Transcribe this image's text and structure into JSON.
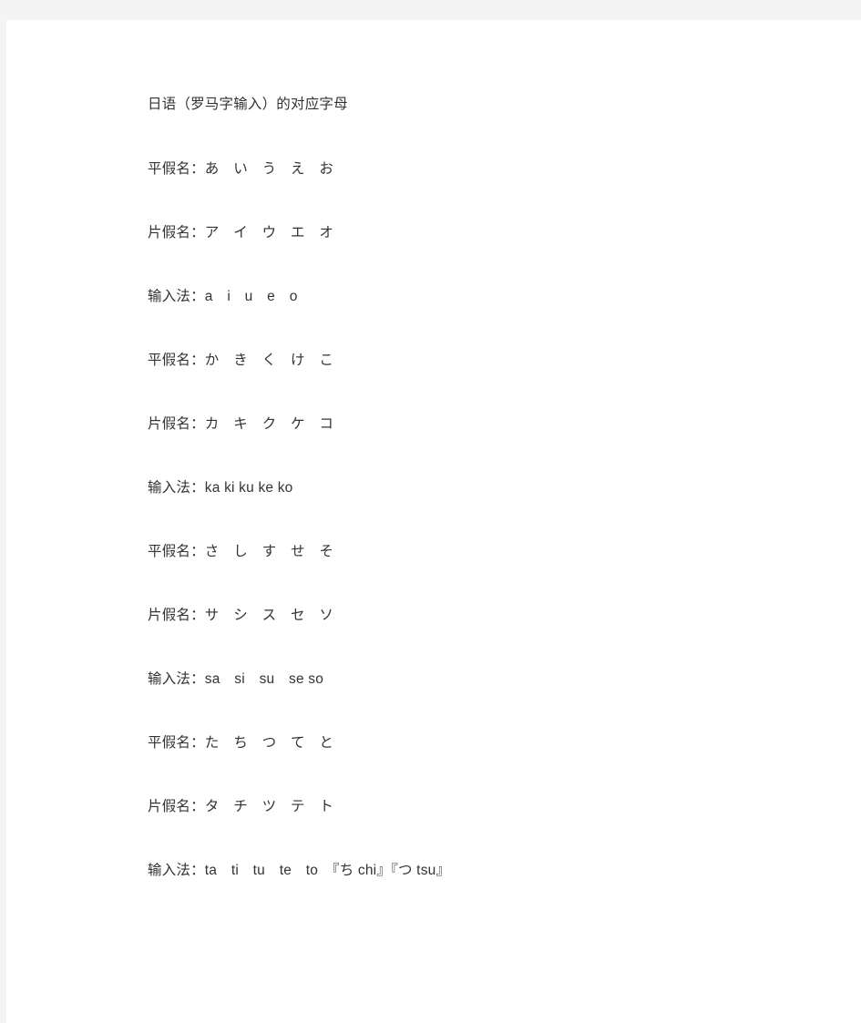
{
  "page": {
    "background_color": "#ffffff",
    "gutter_color": "#f4f4f4",
    "text_color": "#333333"
  },
  "document": {
    "title": "日语（罗马字输入）的对应字母",
    "labels": {
      "hiragana": "平假名",
      "katakana": "片假名",
      "input_method": "输入法"
    },
    "lines": [
      {
        "name": "title",
        "text": "日语（罗马字输入）的对应字母"
      },
      {
        "name": "hiragana-a-row",
        "text": "平假名：あ　い　う　え　お"
      },
      {
        "name": "katakana-a-row",
        "text": "片假名：ア　イ　ウ　エ　オ"
      },
      {
        "name": "romaji-a-row",
        "text": "输入法：a　i　u　e　o"
      },
      {
        "name": "hiragana-ka-row",
        "text": "平假名：か　き　く　け　こ"
      },
      {
        "name": "katakana-ka-row",
        "text": "片假名：カ　キ　ク　ケ　コ"
      },
      {
        "name": "romaji-ka-row",
        "text": "输入法：ka ki ku ke ko"
      },
      {
        "name": "hiragana-sa-row",
        "text": "平假名：さ　し　す　せ　そ"
      },
      {
        "name": "katakana-sa-row",
        "text": "片假名：サ　シ　ス　セ　ソ"
      },
      {
        "name": "romaji-sa-row",
        "text": "输入法：sa　si　su　se so"
      },
      {
        "name": "hiragana-ta-row",
        "text": "平假名：た　ち　つ　て　と"
      },
      {
        "name": "katakana-ta-row",
        "text": "片假名：タ　チ　ツ　テ　ト"
      },
      {
        "name": "romaji-ta-row",
        "text": "输入法：ta　ti　tu　te　to　『ち chi』『つ tsu』"
      }
    ],
    "rows": [
      {
        "row_name": "a-row",
        "hiragana": [
          "あ",
          "い",
          "う",
          "え",
          "お"
        ],
        "katakana": [
          "ア",
          "イ",
          "ウ",
          "エ",
          "オ"
        ],
        "romaji": [
          "a",
          "i",
          "u",
          "e",
          "o"
        ],
        "notes": ""
      },
      {
        "row_name": "ka-row",
        "hiragana": [
          "か",
          "き",
          "く",
          "け",
          "こ"
        ],
        "katakana": [
          "カ",
          "キ",
          "ク",
          "ケ",
          "コ"
        ],
        "romaji": [
          "ka",
          "ki",
          "ku",
          "ke",
          "ko"
        ],
        "notes": ""
      },
      {
        "row_name": "sa-row",
        "hiragana": [
          "さ",
          "し",
          "す",
          "せ",
          "そ"
        ],
        "katakana": [
          "サ",
          "シ",
          "ス",
          "セ",
          "ソ"
        ],
        "romaji": [
          "sa",
          "si",
          "su",
          "se",
          "so"
        ],
        "notes": ""
      },
      {
        "row_name": "ta-row",
        "hiragana": [
          "た",
          "ち",
          "つ",
          "て",
          "と"
        ],
        "katakana": [
          "タ",
          "チ",
          "ツ",
          "テ",
          "ト"
        ],
        "romaji": [
          "ta",
          "ti",
          "tu",
          "te",
          "to"
        ],
        "notes": "『ち chi』『つ tsu』"
      }
    ]
  }
}
